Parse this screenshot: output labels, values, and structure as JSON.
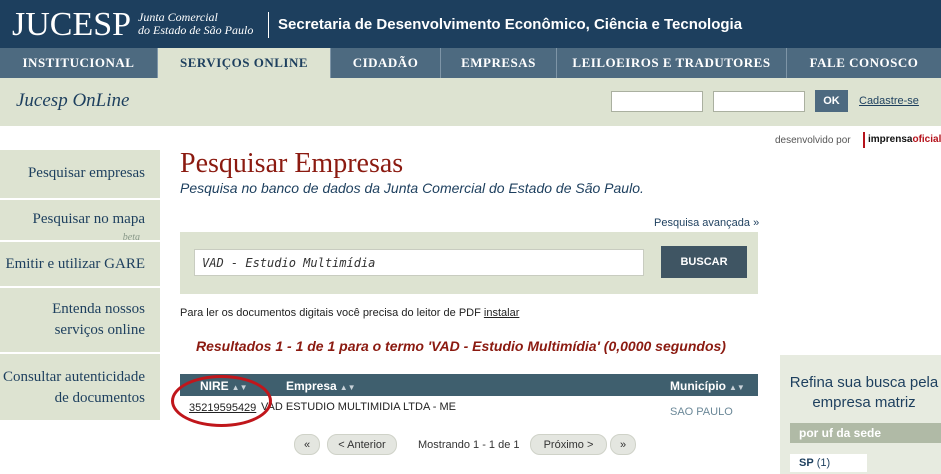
{
  "header": {
    "logo": "JUCESP",
    "logo_sub_1": "Junta Comercial",
    "logo_sub_2": "do Estado de São Paulo",
    "secretaria": "Secretaria de Desenvolvimento Econômico, Ciência e Tecnologia"
  },
  "nav": {
    "items": [
      {
        "label": "INSTITUCIONAL"
      },
      {
        "label": "SERVIÇOS ONLINE"
      },
      {
        "label": "CIDADÃO"
      },
      {
        "label": "EMPRESAS"
      },
      {
        "label": "LEILOEIROS E TRADUTORES"
      },
      {
        "label": "FALE CONOSCO"
      }
    ]
  },
  "subheader": {
    "title": "Jucesp OnLine",
    "ok_label": "OK",
    "cadastre_label": "Cadastre-se"
  },
  "credit": {
    "text": "desenvolvido por",
    "brand_a": "imprensa",
    "brand_b": "oficial"
  },
  "sidebar": {
    "items": [
      {
        "label": "Pesquisar empresas"
      },
      {
        "label": "Pesquisar no mapa",
        "badge": "beta"
      },
      {
        "label": "Emitir e utilizar GARE"
      },
      {
        "label_1": "Entenda nossos",
        "label_2": "serviços online"
      },
      {
        "label_1": "Consultar autenticidade",
        "label_2": "de documentos"
      }
    ]
  },
  "main": {
    "title": "Pesquisar Empresas",
    "subtitle": "Pesquisa no banco de dados da Junta Comercial do Estado de São Paulo.",
    "advanced_link": "Pesquisa avançada »",
    "search_value": "VAD - Estudio Multimídia",
    "search_button": "BUSCAR",
    "pdf_note": "Para ler os documentos digitais você precisa do leitor de PDF",
    "pdf_link": "instalar",
    "results_text": "Resultados 1 - 1 de 1 para o termo 'VAD - Estudio Multimídia' (0,0000 segundos)"
  },
  "table": {
    "columns": [
      "NIRE",
      "Empresa",
      "Município"
    ],
    "rows": [
      {
        "nire": "35219595429",
        "empresa": "VAD ESTUDIO MULTIMIDIA LTDA - ME",
        "municipio": "SAO PAULO"
      }
    ]
  },
  "pagination": {
    "first": "«",
    "prev": "< Anterior",
    "status": "Mostrando 1 - 1 de 1",
    "next": "Próximo >",
    "last": "»"
  },
  "refine": {
    "title_1": "Refina sua busca pela",
    "title_2": "empresa matriz",
    "section": "por uf da sede",
    "uf_code": "SP",
    "uf_count": "(1)"
  }
}
